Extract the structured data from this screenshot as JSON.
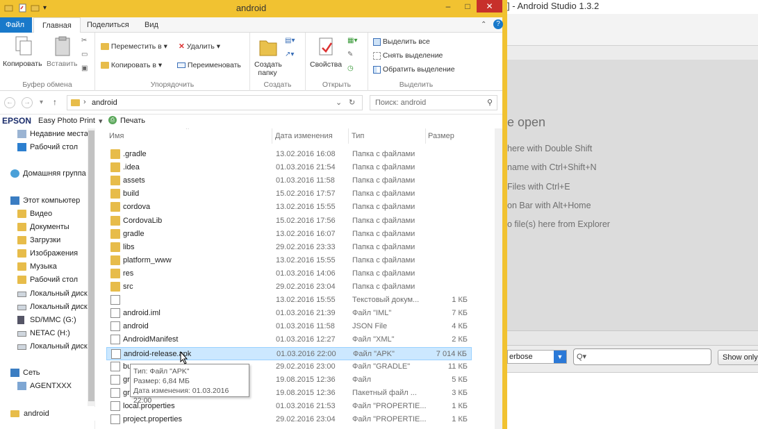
{
  "android_studio": {
    "title": "] - Android Studio 1.3.2",
    "welcome_heading": "e open",
    "hints": [
      "here with Double Shift",
      "name with Ctrl+Shift+N",
      "Files with Ctrl+E",
      "on Bar with Alt+Home",
      "o file(s) here from Explorer"
    ],
    "log_level": "erbose",
    "search_placeholder": "Q▾",
    "show_only_label": "Show only"
  },
  "window": {
    "title": "android",
    "min_label": "–",
    "max_label": "□",
    "close_label": "✕"
  },
  "tabs": [
    "Файл",
    "Главная",
    "Поделиться",
    "Вид"
  ],
  "ribbon": {
    "groups": {
      "clipboard": "Буфер обмена",
      "organize": "Упорядочить",
      "create": "Создать",
      "open": "Открыть",
      "select": "Выделить"
    },
    "copy": "Копировать",
    "paste": "Вставить",
    "move_to": "Переместить в ▾",
    "copy_to": "Копировать в ▾",
    "delete": "Удалить ▾",
    "rename": "Переименовать",
    "new_folder_line1": "Создать",
    "new_folder_line2": "папку",
    "properties": "Свойства",
    "select_all": "Выделить все",
    "select_none": "Снять выделение",
    "invert_selection": "Обратить выделение"
  },
  "address": {
    "path_root": "›",
    "path_folder": "android",
    "search_placeholder": "Поиск: android"
  },
  "epson": {
    "brand": "EPSON",
    "app": "Easy Photo Print",
    "print": "Печать"
  },
  "nav": {
    "items": [
      {
        "label": "Недавние места",
        "icon": "recent-places-icon"
      },
      {
        "label": "Рабочий стол",
        "icon": "desktop-icon"
      },
      {
        "label": "Домашняя группа",
        "icon": "homegroup-icon"
      },
      {
        "label": "Этот компьютер",
        "icon": "computer-icon"
      },
      {
        "label": "Видео",
        "icon": "folder-icon"
      },
      {
        "label": "Документы",
        "icon": "folder-icon"
      },
      {
        "label": "Загрузки",
        "icon": "folder-icon"
      },
      {
        "label": "Изображения",
        "icon": "folder-icon"
      },
      {
        "label": "Музыка",
        "icon": "folder-icon"
      },
      {
        "label": "Рабочий стол",
        "icon": "folder-icon"
      },
      {
        "label": "Локальный диск",
        "icon": "drive-icon"
      },
      {
        "label": "Локальный диск",
        "icon": "drive-icon"
      },
      {
        "label": "SD/MMC (G:)",
        "icon": "sd-card-icon"
      },
      {
        "label": "NETAC (H:)",
        "icon": "usb-drive-icon"
      },
      {
        "label": "Локальный диск",
        "icon": "drive-icon"
      },
      {
        "label": "Сеть",
        "icon": "network-icon"
      },
      {
        "label": "AGENTXXX",
        "icon": "pc-icon"
      }
    ],
    "status_folder": "android"
  },
  "columns": {
    "name": "Имя",
    "date": "Дата изменения",
    "type": "Тип",
    "size": "Размер"
  },
  "files": [
    {
      "name": ".gradle",
      "date": "13.02.2016 16:08",
      "type": "Папка с файлами",
      "size": "",
      "kind": "folder"
    },
    {
      "name": ".idea",
      "date": "01.03.2016 21:54",
      "type": "Папка с файлами",
      "size": "",
      "kind": "folder"
    },
    {
      "name": "assets",
      "date": "01.03.2016 11:58",
      "type": "Папка с файлами",
      "size": "",
      "kind": "folder"
    },
    {
      "name": "build",
      "date": "15.02.2016 17:57",
      "type": "Папка с файлами",
      "size": "",
      "kind": "folder"
    },
    {
      "name": "cordova",
      "date": "13.02.2016 15:55",
      "type": "Папка с файлами",
      "size": "",
      "kind": "folder"
    },
    {
      "name": "CordovaLib",
      "date": "15.02.2016 17:56",
      "type": "Папка с файлами",
      "size": "",
      "kind": "folder"
    },
    {
      "name": "gradle",
      "date": "13.02.2016 16:07",
      "type": "Папка с файлами",
      "size": "",
      "kind": "folder"
    },
    {
      "name": "libs",
      "date": "29.02.2016 23:33",
      "type": "Папка с файлами",
      "size": "",
      "kind": "folder"
    },
    {
      "name": "platform_www",
      "date": "13.02.2016 15:55",
      "type": "Папка с файлами",
      "size": "",
      "kind": "folder"
    },
    {
      "name": "res",
      "date": "01.03.2016 14:06",
      "type": "Папка с файлами",
      "size": "",
      "kind": "folder"
    },
    {
      "name": "src",
      "date": "29.02.2016 23:04",
      "type": "Папка с файлами",
      "size": "",
      "kind": "folder"
    },
    {
      "name": "",
      "date": "13.02.2016 15:55",
      "type": "Текстовый докум...",
      "size": "1 КБ",
      "kind": "file"
    },
    {
      "name": "android.iml",
      "date": "01.03.2016 21:39",
      "type": "Файл \"IML\"",
      "size": "7 КБ",
      "kind": "file"
    },
    {
      "name": "android",
      "date": "01.03.2016 11:58",
      "type": "JSON File",
      "size": "4 КБ",
      "kind": "file"
    },
    {
      "name": "AndroidManifest",
      "date": "01.03.2016 12:27",
      "type": "Файл \"XML\"",
      "size": "2 КБ",
      "kind": "file"
    },
    {
      "name": "android-release.apk",
      "date": "01.03.2016 22:00",
      "type": "Файл \"APK\"",
      "size": "7 014 КБ",
      "kind": "file",
      "selected": true
    },
    {
      "name": "bu",
      "date": "29.02.2016 23:00",
      "type": "Файл \"GRADLE\"",
      "size": "11 КБ",
      "kind": "file"
    },
    {
      "name": "gr",
      "date": "19.08.2015 12:36",
      "type": "Файл",
      "size": "5 КБ",
      "kind": "file"
    },
    {
      "name": "gr",
      "date": "19.08.2015 12:36",
      "type": "Пакетный файл ...",
      "size": "3 КБ",
      "kind": "file"
    },
    {
      "name": "local.properties",
      "date": "01.03.2016 21:53",
      "type": "Файл \"PROPERTIE...",
      "size": "1 КБ",
      "kind": "file"
    },
    {
      "name": "project.properties",
      "date": "29.02.2016 23:04",
      "type": "Файл \"PROPERTIE...",
      "size": "1 КБ",
      "kind": "file"
    }
  ],
  "tooltip": {
    "line1": "Тип: Файл \"APK\"",
    "line2": "Размер: 6,84 МБ",
    "line3": "Дата изменения: 01.03.2016 22:00"
  },
  "colors": {
    "title_accent": "#f1c231",
    "file_tab": "#1979ca",
    "selection": "#cce8ff",
    "folder": "#e7bc4a"
  }
}
